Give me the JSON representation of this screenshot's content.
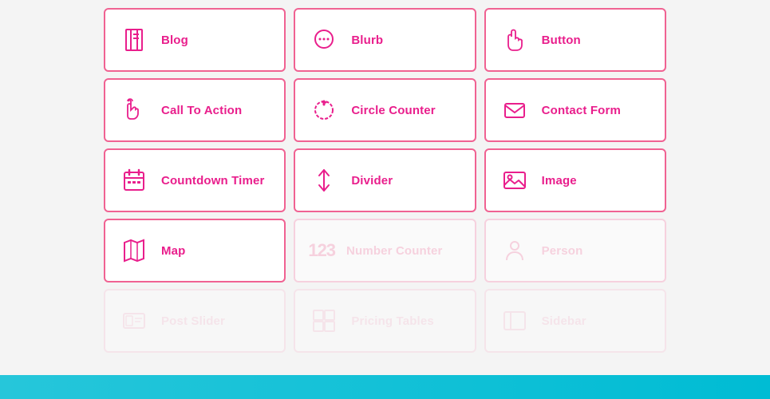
{
  "widgets": {
    "row1": [
      {
        "id": "blog",
        "label": "Blog",
        "icon": "book",
        "faded": false
      },
      {
        "id": "blurb",
        "label": "Blurb",
        "icon": "chat",
        "faded": false
      },
      {
        "id": "button",
        "label": "Button",
        "icon": "hand",
        "faded": false,
        "partial": true
      }
    ],
    "row2": [
      {
        "id": "call-to-action",
        "label": "Call To Action",
        "icon": "pointer",
        "faded": false
      },
      {
        "id": "circle-counter",
        "label": "Circle Counter",
        "icon": "circle-refresh",
        "faded": false
      },
      {
        "id": "contact-form",
        "label": "Contact Form",
        "icon": "envelope",
        "faded": false,
        "partial": true
      }
    ],
    "row3": [
      {
        "id": "countdown-timer",
        "label": "Countdown Timer",
        "icon": "calendar",
        "faded": false
      },
      {
        "id": "divider",
        "label": "Divider",
        "icon": "divider-arrow",
        "faded": false
      },
      {
        "id": "image",
        "label": "Image",
        "icon": "image",
        "faded": false,
        "partial": true
      }
    ],
    "row4": [
      {
        "id": "map",
        "label": "Map",
        "icon": "map",
        "faded": false
      },
      {
        "id": "number-counter",
        "label": "Number Counter",
        "icon": "123",
        "faded": true
      },
      {
        "id": "person",
        "label": "Person",
        "icon": "person",
        "faded": true,
        "partial": true
      }
    ],
    "row5": [
      {
        "id": "post-slider",
        "label": "Post Slider",
        "icon": "post-slider",
        "faded": true
      },
      {
        "id": "pricing-tables",
        "label": "Pricing Tables",
        "icon": "grid",
        "faded": true
      },
      {
        "id": "sidebar",
        "label": "Sidebar",
        "icon": "sidebar",
        "faded": true,
        "partial": true
      }
    ]
  }
}
